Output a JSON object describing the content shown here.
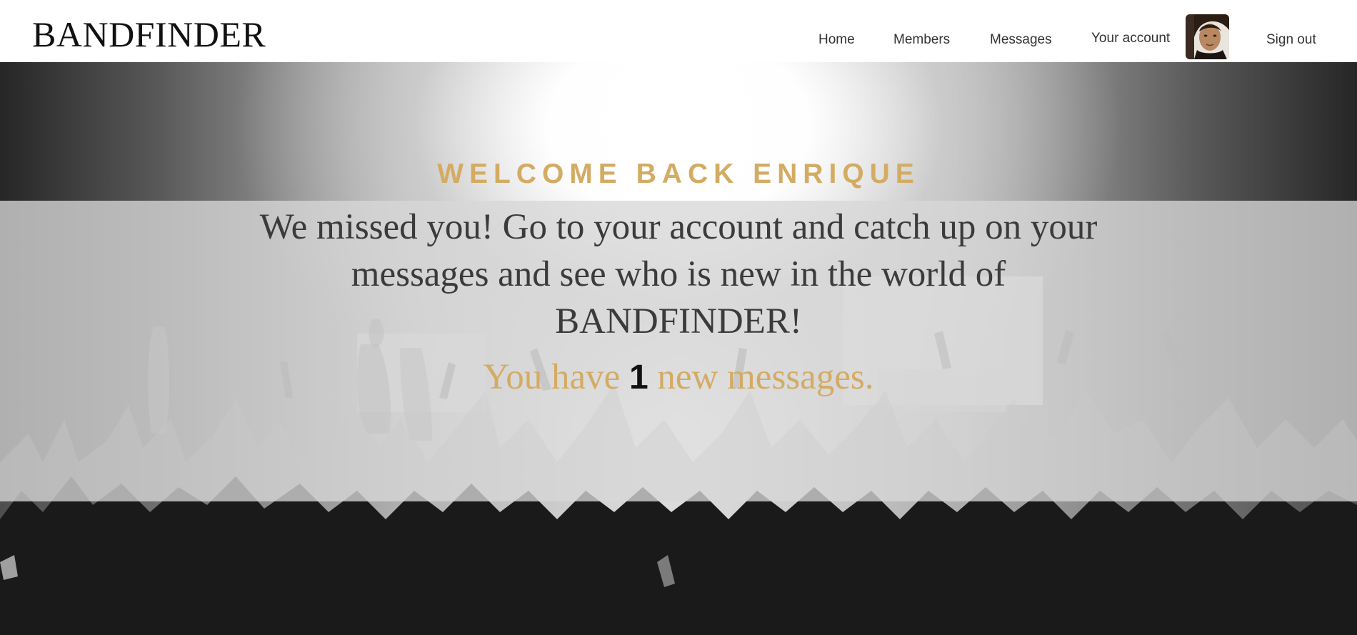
{
  "header": {
    "logo": "BANDFINDER",
    "nav": {
      "home": "Home",
      "members": "Members",
      "messages": "Messages",
      "account": "Your account",
      "signout": "Sign out"
    }
  },
  "welcome": {
    "title": "WELCOME BACK ENRIQUE",
    "body": "We missed you! Go to your account and catch up on your messages and see who is new in the world of BANDFINDER!",
    "count_prefix": "You have",
    "count": "1",
    "count_suffix": "new messages."
  },
  "colors": {
    "accent": "#d4ab63",
    "header_bg": "#ffffff",
    "text_dark": "#3b3b3b"
  }
}
